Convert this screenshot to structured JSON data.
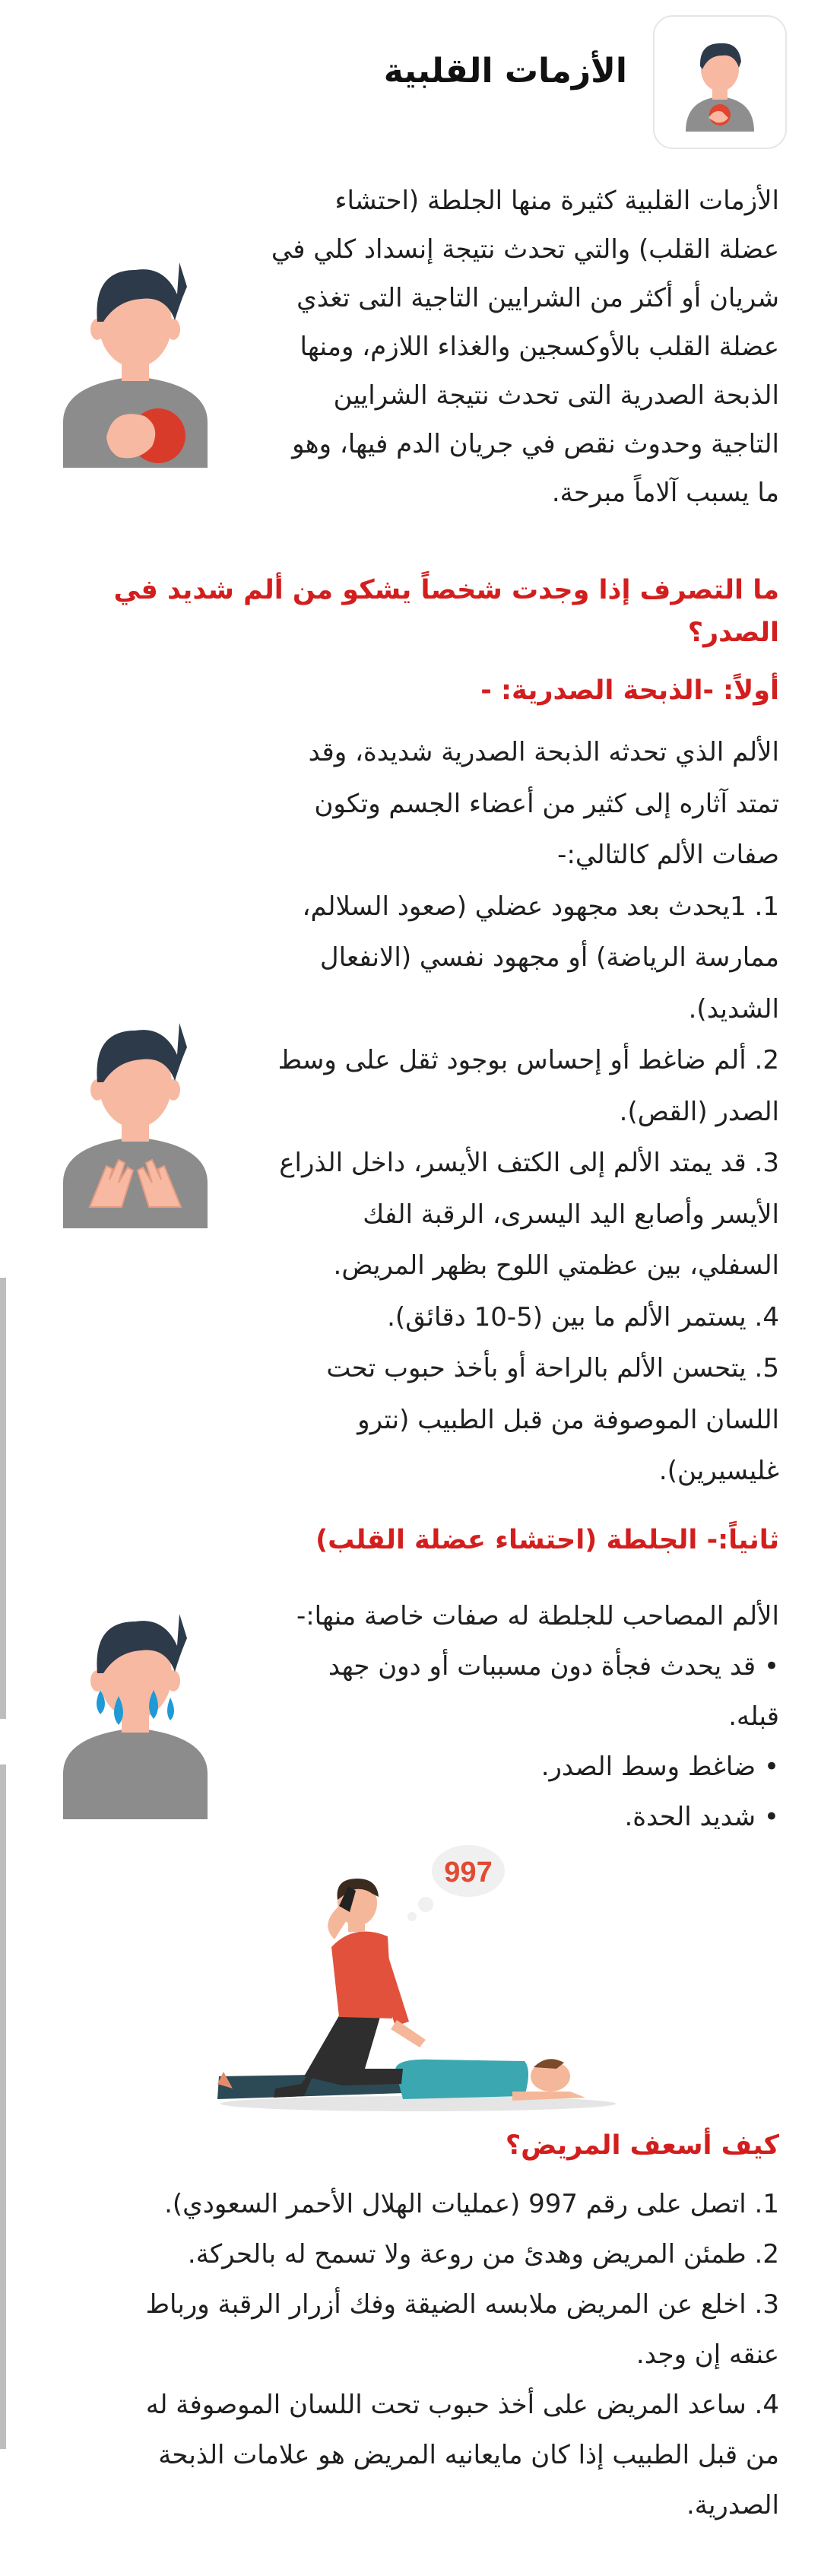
{
  "header": {
    "title": "الأزمات القلبية",
    "icon": "heart-patient-icon"
  },
  "intro": {
    "lines": [
      "الأزمات القلبية كثيرة منها الجلطة (احتشاء",
      "عضلة القلب) والتي تحدث نتيجة إنسداد كلي في",
      "شريان أو أكثر من الشرايين التاجية التى تغذي",
      "عضلة القلب بالأوكسجين والغذاء اللازم، ومنها",
      "الذبحة الصدرية التى تحدث نتيجة الشرايين",
      "التاجية وحدوث نقص في جريان الدم فيها، وهو",
      "ما يسبب آلاماً مبرحة."
    ]
  },
  "question": {
    "lines": [
      "ما التصرف إذا وجدت شخصاً يشكو من ألم شديد في",
      "الصدر؟"
    ]
  },
  "angina": {
    "heading": "أولاً: -الذبحة الصدرية: -",
    "lines": [
      "الألم الذي تحدثه الذبحة الصدرية شديدة، وقد",
      "تمتد آثاره إلى كثير من أعضاء الجسم وتكون",
      "صفات الألم كالتالي:-",
      "1. 1يحدث بعد مجهود عضلي (صعود السلالم،",
      "ممارسة الرياضة) أو مجهود نفسي (الانفعال",
      "الشديد).",
      "2. ألم ضاغط أو إحساس بوجود ثقل على وسط",
      "الصدر (القص).",
      "3. قد يمتد الألم إلى الكتف الأيسر، داخل الذراع",
      "الأيسر وأصابع اليد اليسرى، الرقبة الفك",
      "السفلي، بين عظمتي اللوح بظهر المريض.",
      "4. يستمر الألم ما بين (5-10 دقائق).",
      "5. يتحسن الألم بالراحة أو بأخذ حبوب تحت",
      "اللسان الموصوفة من قبل الطبيب (نترو",
      "غليسيرين)."
    ]
  },
  "infarction": {
    "heading": "ثانياً:- الجلطة (احتشاء عضلة القلب)",
    "lines": [
      "الألم المصاحب للجلطة له صفات خاصة منها:-",
      "• قد يحدث فجأة دون مسببات أو دون جهد",
      "قبله.",
      "• ضاغط وسط الصدر.",
      "• شديد الحدة."
    ]
  },
  "illustration": {
    "bubble": "997"
  },
  "aid": {
    "heading": "كيف أسعف المريض؟",
    "lines": [
      "1. اتصل على رقم 997 (عمليات الهلال الأحمر السعودي).",
      "2. طمئن المريض وهدئ من روعة ولا تسمح له بالحركة.",
      "3. اخلع عن المريض ملابسه الضيقة وفك أزرار الرقبة ورباط",
      "عنقه إن وجد.",
      "4. ساعد المريض على أخذ حبوب تحت اللسان الموصوفة له",
      "من قبل الطبيب إذا كان مايعانيه المريض هو علامات الذبحة",
      "الصدرية."
    ]
  }
}
